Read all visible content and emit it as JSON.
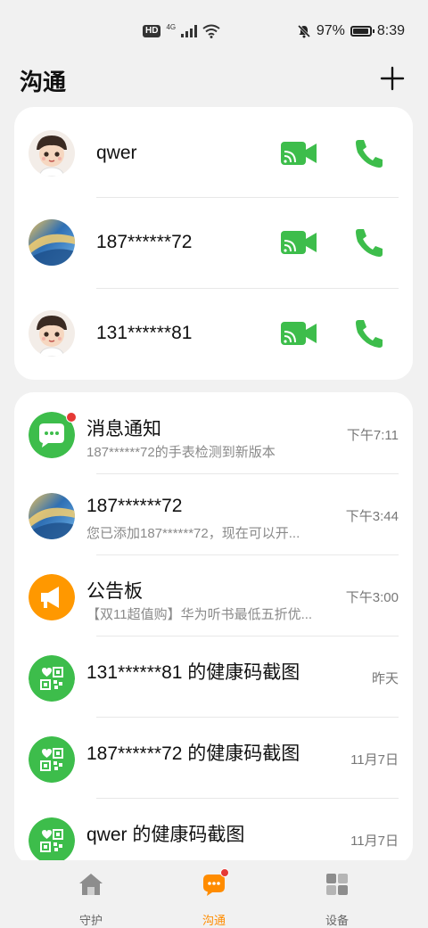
{
  "status_bar": {
    "network": "4G",
    "battery": "97%",
    "battery_level": 0.97,
    "time": "8:39"
  },
  "header": {
    "title": "沟通"
  },
  "contacts": [
    {
      "name": "qwer"
    },
    {
      "name": "187******72"
    },
    {
      "name": "131******81"
    }
  ],
  "messages": [
    {
      "title": "消息通知",
      "subtitle": "187******72的手表检测到新版本",
      "time": "下午7:11"
    },
    {
      "title": "187******72",
      "subtitle": "您已添加187******72，现在可以开...",
      "time": "下午3:44"
    },
    {
      "title": "公告板",
      "subtitle": "【双11超值购】华为听书最低五折优...",
      "time": "下午3:00"
    },
    {
      "title": "131******81 的健康码截图",
      "subtitle": "",
      "time": "昨天"
    },
    {
      "title": "187******72 的健康码截图",
      "subtitle": "",
      "time": "11月7日"
    },
    {
      "title": "qwer 的健康码截图",
      "subtitle": "",
      "time": "11月7日"
    }
  ],
  "nav": {
    "items": [
      {
        "label": "守护",
        "icon": "home-icon"
      },
      {
        "label": "沟通",
        "icon": "chat-icon"
      },
      {
        "label": "设备",
        "icon": "grid-icon"
      }
    ]
  },
  "colors": {
    "green": "#3dbd4b",
    "orange": "#ff9800",
    "active_tab": "#ff8c00",
    "badge_red": "#e53935"
  }
}
